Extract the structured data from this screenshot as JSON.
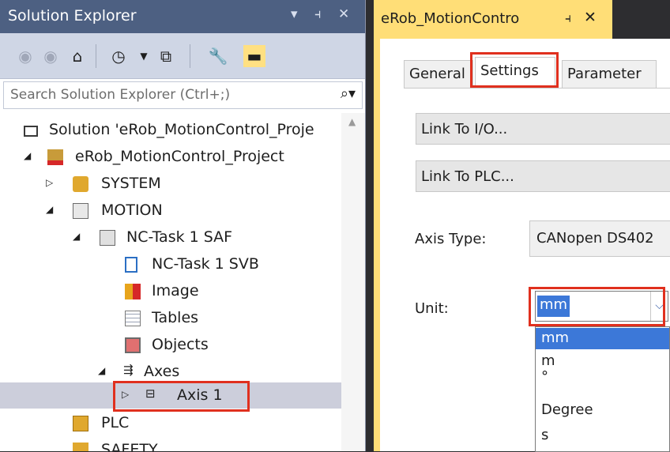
{
  "solution_explorer": {
    "title": "Solution Explorer",
    "title_controls": {
      "dropdown": "▾",
      "pin": "⫞",
      "close": "✕"
    },
    "toolbar": [
      "back-icon",
      "forward-icon",
      "home-icon",
      "history-icon",
      "dropdown-icon",
      "collapse-icon",
      "properties-icon",
      "pin-toolbar-icon"
    ],
    "search": {
      "placeholder": "Search Solution Explorer (Ctrl+;)",
      "icon": "search-icon"
    },
    "tree": [
      {
        "label": "Solution 'eRob_MotionControl_Proje",
        "icon": "solution-icon"
      },
      {
        "label": "eRob_MotionControl_Project",
        "icon": "project-icon"
      },
      {
        "label": "SYSTEM",
        "icon": "system-icon"
      },
      {
        "label": "MOTION",
        "icon": "motion-icon"
      },
      {
        "label": "NC-Task 1 SAF",
        "icon": "nc-task-icon"
      },
      {
        "label": "NC-Task 1 SVB",
        "icon": "svb-icon"
      },
      {
        "label": "Image",
        "icon": "image-icon"
      },
      {
        "label": "Tables",
        "icon": "tables-icon"
      },
      {
        "label": "Objects",
        "icon": "objects-icon"
      },
      {
        "label": "Axes",
        "icon": "axes-icon"
      },
      {
        "label": "Axis 1",
        "icon": "axis-icon",
        "selected": true
      },
      {
        "label": "PLC",
        "icon": "plc-icon"
      },
      {
        "label": "SAFETY",
        "icon": "safety-icon"
      }
    ]
  },
  "document": {
    "tab_title": "eRob_MotionContro",
    "tab_pin": "⫞",
    "tab_close": "✕",
    "subtabs": [
      "General",
      "Settings",
      "Parameter"
    ],
    "active_subtab": "Settings",
    "buttons": {
      "link_io": "Link To I/O...",
      "link_plc": "Link To PLC..."
    },
    "axis_type": {
      "label": "Axis Type:",
      "value": "CANopen DS402"
    },
    "unit": {
      "label": "Unit:",
      "selected": "mm",
      "options": [
        "mm",
        "m",
        "°",
        "Degree",
        "s"
      ]
    }
  },
  "colors": {
    "title_bar": "#4d6082",
    "doc_tab": "#ffde77",
    "highlight": "#e0301e",
    "selection": "#3c78d8"
  }
}
